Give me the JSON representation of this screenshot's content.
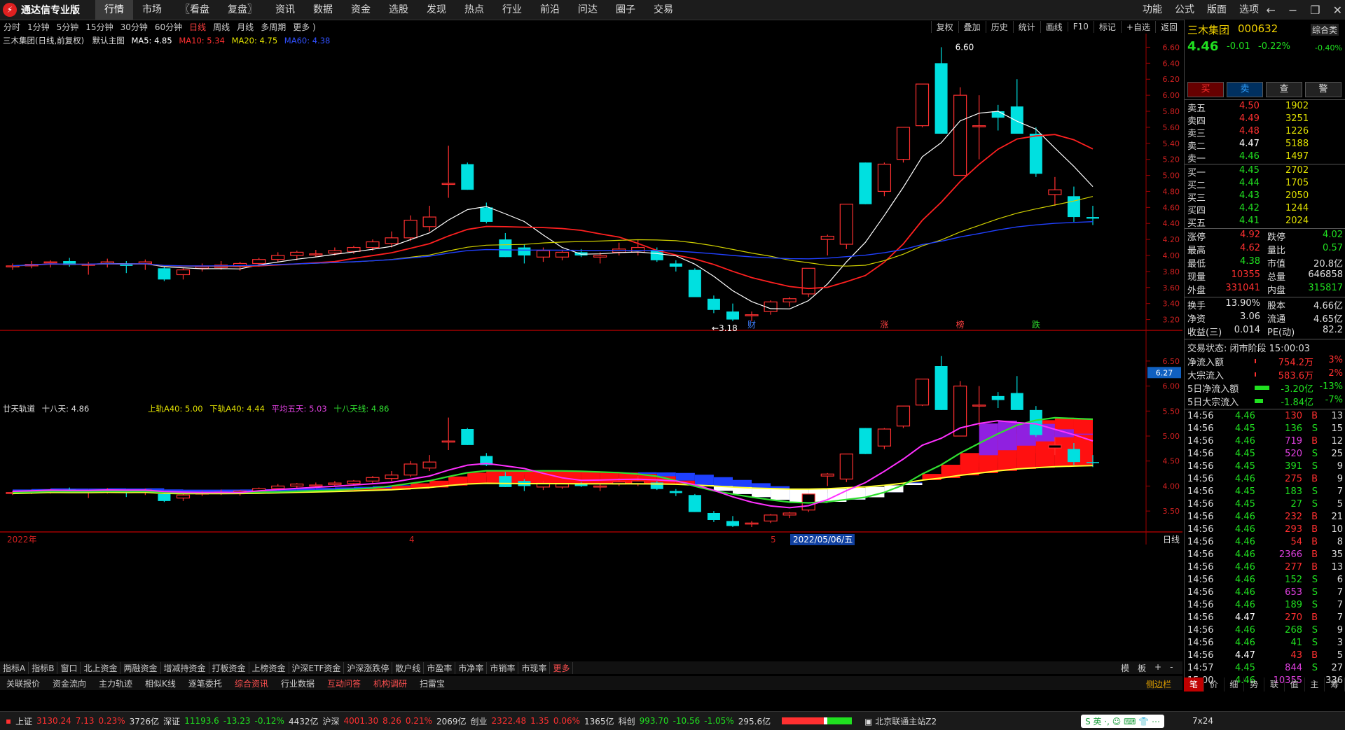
{
  "app": {
    "title": "通达信专业版",
    "menus": [
      "行情",
      "市场",
      "〖看盘",
      "复盘〗",
      "资讯",
      "数据",
      "资金",
      "选股",
      "发现",
      "热点",
      "行业",
      "前沿",
      "问达",
      "圈子",
      "交易"
    ],
    "right_menus": [
      "功能",
      "公式",
      "版面",
      "选项"
    ]
  },
  "periods": [
    "分时",
    "1分钟",
    "5分钟",
    "15分钟",
    "30分钟",
    "60分钟",
    "日线",
    "周线",
    "月线",
    "多周期",
    "更多 )"
  ],
  "tools": [
    "复权",
    "叠加",
    "历史",
    "统计",
    "画线",
    "F10",
    "标记",
    "+自选",
    "返回"
  ],
  "main_chart": {
    "header": {
      "stock": "三木集团(日线,前复权)",
      "theme": "默认主图",
      "ma5": "MA5: 4.85",
      "ma10": "MA10: 5.34",
      "ma20": "MA20: 4.75",
      "ma60": "MA60: 4.38"
    },
    "high_label": "6.60",
    "low_label": "3.18",
    "markers": [
      "财",
      "涨",
      "榜",
      "跌"
    ],
    "y_ticks": [
      "6.60",
      "6.40",
      "6.20",
      "6.00",
      "5.80",
      "5.60",
      "5.40",
      "5.20",
      "5.00",
      "4.80",
      "4.60",
      "4.40",
      "4.20",
      "4.00",
      "3.80",
      "3.60",
      "3.40",
      "3.20"
    ]
  },
  "sub_chart": {
    "header": {
      "name": "廿天轨道",
      "eighteen": "十八天: 4.86",
      "upper": "上轨A40: 5.00",
      "lower": "下轨A40: 4.44",
      "avg5": "平均五天: 5.03",
      "line18": "十八天线: 4.86"
    },
    "current_tag": "6.27",
    "y_ticks": [
      "6.50",
      "6.00",
      "5.50",
      "5.00",
      "4.50",
      "4.00",
      "3.50"
    ]
  },
  "xaxis": {
    "start": "2022年",
    "m4": "4",
    "m5": "5",
    "cursor_date": "2022/05/06/五",
    "period": "日线"
  },
  "chart_data": {
    "type": "candlestick",
    "title": "三木集团(日线,前复权)",
    "ylim": [
      3.1,
      6.7
    ],
    "candles": [
      {
        "o": 3.86,
        "h": 3.9,
        "l": 3.82,
        "c": 3.87
      },
      {
        "o": 3.87,
        "h": 3.93,
        "l": 3.84,
        "c": 3.89
      },
      {
        "o": 3.91,
        "h": 3.94,
        "l": 3.85,
        "c": 3.92
      },
      {
        "o": 3.93,
        "h": 3.97,
        "l": 3.86,
        "c": 3.88
      },
      {
        "o": 3.88,
        "h": 3.92,
        "l": 3.76,
        "c": 3.89
      },
      {
        "o": 3.9,
        "h": 3.96,
        "l": 3.85,
        "c": 3.92
      },
      {
        "o": 3.9,
        "h": 3.93,
        "l": 3.78,
        "c": 3.87
      },
      {
        "o": 3.9,
        "h": 3.95,
        "l": 3.82,
        "c": 3.92
      },
      {
        "o": 3.84,
        "h": 3.86,
        "l": 3.68,
        "c": 3.7
      },
      {
        "o": 3.76,
        "h": 3.84,
        "l": 3.7,
        "c": 3.82
      },
      {
        "o": 3.84,
        "h": 3.9,
        "l": 3.8,
        "c": 3.86
      },
      {
        "o": 3.85,
        "h": 3.93,
        "l": 3.82,
        "c": 3.88
      },
      {
        "o": 3.86,
        "h": 3.92,
        "l": 3.81,
        "c": 3.9
      },
      {
        "o": 3.9,
        "h": 3.97,
        "l": 3.86,
        "c": 3.95
      },
      {
        "o": 3.95,
        "h": 4.04,
        "l": 3.92,
        "c": 4.0
      },
      {
        "o": 4.0,
        "h": 4.06,
        "l": 3.94,
        "c": 4.04
      },
      {
        "o": 4.02,
        "h": 4.07,
        "l": 3.98,
        "c": 4.02
      },
      {
        "o": 4.03,
        "h": 4.1,
        "l": 4.0,
        "c": 4.06
      },
      {
        "o": 4.05,
        "h": 4.12,
        "l": 4.02,
        "c": 4.1
      },
      {
        "o": 4.1,
        "h": 4.2,
        "l": 4.06,
        "c": 4.17
      },
      {
        "o": 4.15,
        "h": 4.3,
        "l": 4.1,
        "c": 4.22
      },
      {
        "o": 4.22,
        "h": 4.5,
        "l": 4.18,
        "c": 4.44
      },
      {
        "o": 4.36,
        "h": 4.62,
        "l": 4.3,
        "c": 4.48
      },
      {
        "o": 4.9,
        "h": 5.37,
        "l": 4.72,
        "c": 4.9
      },
      {
        "o": 5.14,
        "h": 5.16,
        "l": 4.82,
        "c": 4.82
      },
      {
        "o": 4.6,
        "h": 4.66,
        "l": 4.4,
        "c": 4.42
      },
      {
        "o": 4.2,
        "h": 4.28,
        "l": 3.98,
        "c": 3.98
      },
      {
        "o": 4.1,
        "h": 4.14,
        "l": 3.9,
        "c": 4.0
      },
      {
        "o": 3.98,
        "h": 4.1,
        "l": 3.92,
        "c": 4.06
      },
      {
        "o": 3.98,
        "h": 4.06,
        "l": 3.94,
        "c": 4.04
      },
      {
        "o": 4.04,
        "h": 4.08,
        "l": 3.98,
        "c": 4.0
      },
      {
        "o": 3.98,
        "h": 4.04,
        "l": 3.9,
        "c": 4.0
      },
      {
        "o": 4.04,
        "h": 4.16,
        "l": 4.0,
        "c": 4.08
      },
      {
        "o": 4.04,
        "h": 4.2,
        "l": 4.0,
        "c": 4.1
      },
      {
        "o": 4.07,
        "h": 4.1,
        "l": 3.92,
        "c": 3.94
      },
      {
        "o": 3.9,
        "h": 3.94,
        "l": 3.8,
        "c": 3.86
      },
      {
        "o": 3.82,
        "h": 3.84,
        "l": 3.48,
        "c": 3.48
      },
      {
        "o": 3.46,
        "h": 3.5,
        "l": 3.28,
        "c": 3.32
      },
      {
        "o": 3.3,
        "h": 3.4,
        "l": 3.18,
        "c": 3.2
      },
      {
        "o": 3.26,
        "h": 3.3,
        "l": 3.18,
        "c": 3.26
      },
      {
        "o": 3.3,
        "h": 3.44,
        "l": 3.26,
        "c": 3.42
      },
      {
        "o": 3.42,
        "h": 3.48,
        "l": 3.36,
        "c": 3.46
      },
      {
        "o": 3.52,
        "h": 3.84,
        "l": 3.48,
        "c": 3.84
      },
      {
        "o": 4.2,
        "h": 4.26,
        "l": 4.0,
        "c": 4.24
      },
      {
        "o": 4.14,
        "h": 4.64,
        "l": 4.08,
        "c": 4.64
      },
      {
        "o": 5.16,
        "h": 5.16,
        "l": 4.64,
        "c": 4.64
      },
      {
        "o": 4.8,
        "h": 5.16,
        "l": 4.74,
        "c": 5.14
      },
      {
        "o": 5.2,
        "h": 5.6,
        "l": 5.16,
        "c": 5.6
      },
      {
        "o": 5.62,
        "h": 6.14,
        "l": 5.6,
        "c": 6.14
      },
      {
        "o": 6.4,
        "h": 6.6,
        "l": 5.52,
        "c": 5.52
      },
      {
        "o": 5.0,
        "h": 6.1,
        "l": 5.0,
        "c": 6.0
      },
      {
        "o": 5.62,
        "h": 6.0,
        "l": 5.2,
        "c": 5.62
      },
      {
        "o": 5.8,
        "h": 5.88,
        "l": 5.56,
        "c": 5.72
      },
      {
        "o": 5.86,
        "h": 6.2,
        "l": 5.66,
        "c": 5.52
      },
      {
        "o": 5.52,
        "h": 5.6,
        "l": 4.98,
        "c": 5.02
      },
      {
        "o": 4.76,
        "h": 4.98,
        "l": 4.62,
        "c": 4.82
      },
      {
        "o": 4.74,
        "h": 4.86,
        "l": 4.42,
        "c": 4.48
      },
      {
        "o": 4.48,
        "h": 4.62,
        "l": 4.38,
        "c": 4.46
      }
    ]
  },
  "quote": {
    "name": "三木集团",
    "code": "000632",
    "badge": "综合类",
    "price": "4.46",
    "change": "-0.01",
    "pct": "-0.22%",
    "sector_pct": "-0.40%",
    "buttons": [
      "买",
      "卖",
      "查",
      "警"
    ],
    "asks": [
      {
        "label": "卖五",
        "price": "4.50",
        "vol": "1902"
      },
      {
        "label": "卖四",
        "price": "4.49",
        "vol": "3251"
      },
      {
        "label": "卖三",
        "price": "4.48",
        "vol": "1226"
      },
      {
        "label": "卖二",
        "price": "4.47",
        "vol": "5188"
      },
      {
        "label": "卖一",
        "price": "4.46",
        "vol": "1497"
      }
    ],
    "bids": [
      {
        "label": "买一",
        "price": "4.45",
        "vol": "2702"
      },
      {
        "label": "买二",
        "price": "4.44",
        "vol": "1705"
      },
      {
        "label": "买三",
        "price": "4.43",
        "vol": "2050"
      },
      {
        "label": "买四",
        "price": "4.42",
        "vol": "1244"
      },
      {
        "label": "买五",
        "price": "4.41",
        "vol": "2024"
      }
    ],
    "stats": [
      {
        "l1": "涨停",
        "v1": "4.92",
        "c1": "red",
        "l2": "跌停",
        "v2": "4.02",
        "c2": "green"
      },
      {
        "l1": "最高",
        "v1": "4.62",
        "c1": "red",
        "l2": "量比",
        "v2": "0.57",
        "c2": "green"
      },
      {
        "l1": "最低",
        "v1": "4.38",
        "c1": "green",
        "l2": "市值",
        "v2": "20.8亿",
        "c2": "white"
      },
      {
        "l1": "现量",
        "v1": "10355",
        "c1": "red",
        "l2": "总量",
        "v2": "646858",
        "c2": "white"
      },
      {
        "l1": "外盘",
        "v1": "331041",
        "c1": "red",
        "l2": "内盘",
        "v2": "315817",
        "c2": "green"
      }
    ],
    "stats2": [
      {
        "l1": "换手",
        "v1": "13.90%",
        "l2": "股本",
        "v2": "4.66亿"
      },
      {
        "l1": "净资",
        "v1": "3.06",
        "l2": "流通",
        "v2": "4.65亿"
      },
      {
        "l1": "收益(三)",
        "v1": "0.014",
        "l2": "PE(动)",
        "v2": "82.2"
      }
    ],
    "trade_state": "交易状态: 闭市阶段 15:00:03",
    "flows": [
      {
        "label": "净流入额",
        "val": "754.2万",
        "pct": "3%",
        "color": "red",
        "bar": 0.05
      },
      {
        "label": "大宗流入",
        "val": "583.6万",
        "pct": "2%",
        "color": "red",
        "bar": 0.04
      },
      {
        "label": "5日净流入额",
        "val": "-3.20亿",
        "pct": "-13%",
        "color": "green",
        "bar": 0.7
      },
      {
        "label": "5日大宗流入",
        "val": "-1.84亿",
        "pct": "-7%",
        "color": "green",
        "bar": 0.4
      }
    ],
    "ticks": [
      [
        "14:56",
        "4.46",
        "130",
        "B",
        "13"
      ],
      [
        "14:56",
        "4.45",
        "136",
        "S",
        "15"
      ],
      [
        "14:56",
        "4.46",
        "719",
        "B",
        "12"
      ],
      [
        "14:56",
        "4.45",
        "520",
        "S",
        "25"
      ],
      [
        "14:56",
        "4.45",
        "391",
        "S",
        "9"
      ],
      [
        "14:56",
        "4.46",
        "275",
        "B",
        "9"
      ],
      [
        "14:56",
        "4.45",
        "183",
        "S",
        "7"
      ],
      [
        "14:56",
        "4.45",
        "27",
        "S",
        "5"
      ],
      [
        "14:56",
        "4.46",
        "232",
        "B",
        "21"
      ],
      [
        "14:56",
        "4.46",
        "293",
        "B",
        "10"
      ],
      [
        "14:56",
        "4.46",
        "54",
        "B",
        "8"
      ],
      [
        "14:56",
        "4.46",
        "2366",
        "B",
        "35"
      ],
      [
        "14:56",
        "4.46",
        "277",
        "B",
        "13"
      ],
      [
        "14:56",
        "4.46",
        "152",
        "S",
        "6"
      ],
      [
        "14:56",
        "4.46",
        "653",
        "S",
        "7"
      ],
      [
        "14:56",
        "4.46",
        "189",
        "S",
        "7"
      ],
      [
        "14:56",
        "4.47",
        "270",
        "B",
        "7"
      ],
      [
        "14:56",
        "4.46",
        "268",
        "S",
        "9"
      ],
      [
        "14:56",
        "4.46",
        "41",
        "S",
        "3"
      ],
      [
        "14:56",
        "4.47",
        "43",
        "B",
        "5"
      ],
      [
        "14:57",
        "4.45",
        "844",
        "S",
        "27"
      ],
      [
        "15:00",
        "4.46",
        "10355",
        "",
        "336"
      ]
    ]
  },
  "bottom_tabs1": [
    "指标A",
    "指标B",
    "窗口",
    "北上资金",
    "两融资金",
    "增减持资金",
    "打板资金",
    "上榜资金",
    "沪深ETF资金",
    "沪深涨跌停",
    "散户线",
    "市盈率",
    "市净率",
    "市销率",
    "市现率",
    "更多"
  ],
  "bottom_right1": [
    "模",
    "板",
    "+",
    "-"
  ],
  "bottom_tabs2": [
    "关联报价",
    "资金流向",
    "主力轨迹",
    "相似K线",
    "逐笔委托",
    "综合资讯",
    "行业数据",
    "互动问答",
    "机构调研",
    "扫雷宝"
  ],
  "side_right2": "侧边栏",
  "side_tabs": [
    "笔",
    "价",
    "细",
    "势",
    "联",
    "值",
    "主",
    "筹"
  ],
  "status": {
    "sh_label": "上证",
    "sh_val": "3130.24",
    "sh_chg": "7.13",
    "sh_pct": "0.23%",
    "sh_amt": "3726亿",
    "sz_label": "深证",
    "sz_val": "11193.6",
    "sz_chg": "-13.23",
    "sz_pct": "-0.12%",
    "sz_amt": "4432亿",
    "hs_label": "沪深",
    "hs_val": "4001.30",
    "hs_chg": "8.26",
    "hs_pct": "0.21%",
    "hs_amt": "2069亿",
    "cy_label": "创业",
    "cy_val": "2322.48",
    "cy_chg": "1.35",
    "cy_pct": "0.06%",
    "cy_amt": "1365亿",
    "kc_label": "科创",
    "kc_val": "993.70",
    "kc_chg": "-10.56",
    "kc_pct": "-1.05%",
    "kc_amt": "295.6亿",
    "server": "北京联通主站Z2",
    "ime": "英",
    "clock": "7x24"
  },
  "colors": {
    "up": "#ff3030",
    "down": "#00e0e0",
    "ma5": "#ffffff",
    "ma10": "#ff2020",
    "ma20": "#d0d000",
    "ma60": "#2040ff"
  }
}
